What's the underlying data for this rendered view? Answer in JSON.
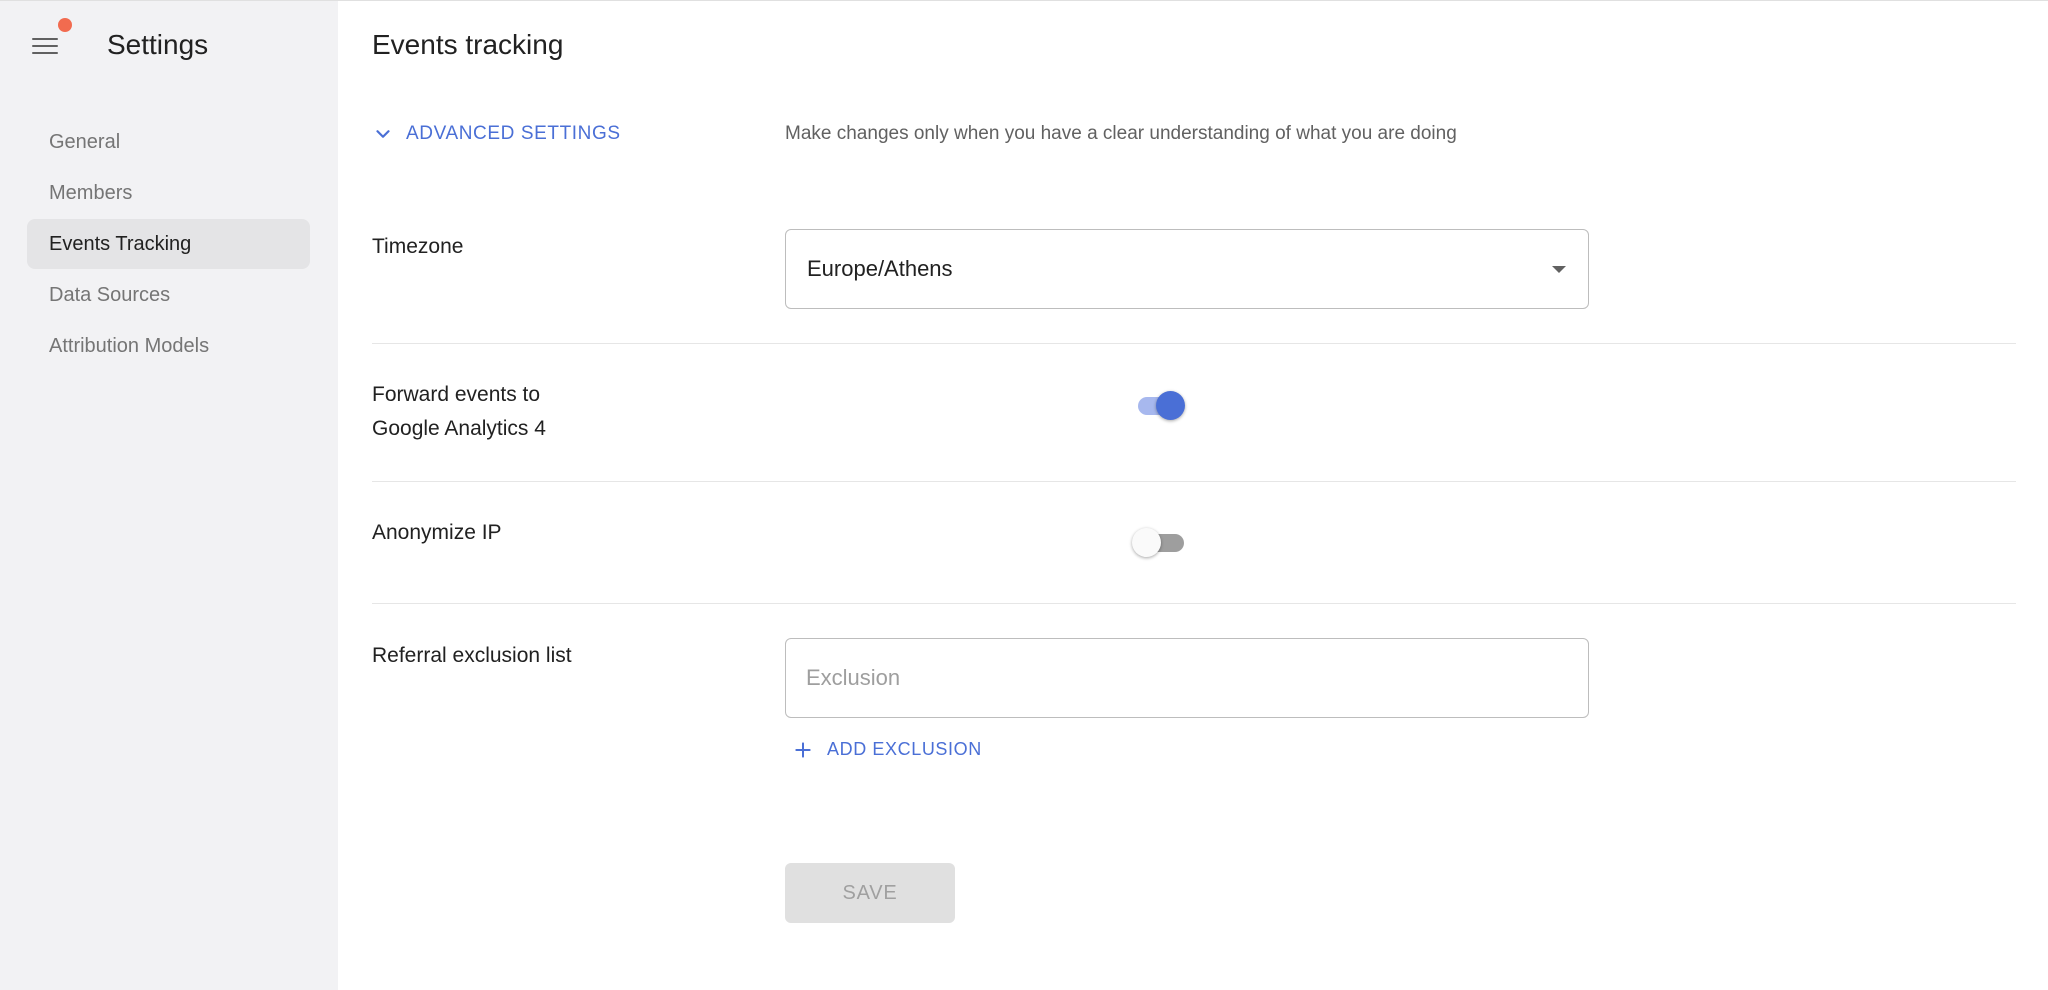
{
  "sidebar": {
    "title": "Settings",
    "items": [
      {
        "label": "General"
      },
      {
        "label": "Members"
      },
      {
        "label": "Events Tracking",
        "active": true
      },
      {
        "label": "Data Sources"
      },
      {
        "label": "Attribution Models"
      }
    ]
  },
  "main": {
    "title": "Events tracking",
    "advanced": {
      "label": "ADVANCED SETTINGS",
      "hint": "Make changes only when you have a clear understanding of what you are doing",
      "expanded": true
    },
    "timezone": {
      "label": "Timezone",
      "value": "Europe/Athens"
    },
    "forward": {
      "label_line1": "Forward events to",
      "label_line2": "Google Analytics 4",
      "enabled": true
    },
    "anonymize": {
      "label": "Anonymize IP",
      "enabled": false
    },
    "referral": {
      "label": "Referral exclusion list",
      "placeholder": "Exclusion",
      "value": "",
      "add_label": "ADD EXCLUSION"
    },
    "save_label": "SAVE"
  },
  "colors": {
    "accent": "#4a6fd6",
    "notification": "#f26b4f",
    "sidebar_bg": "#f2f2f4",
    "disabled_button": "#e0e0e0"
  },
  "icons": {
    "menu": "hamburger-icon",
    "notification": "notification-dot-icon",
    "advanced": "chevron-down-icon",
    "select": "dropdown-arrow-icon",
    "add": "plus-icon"
  }
}
